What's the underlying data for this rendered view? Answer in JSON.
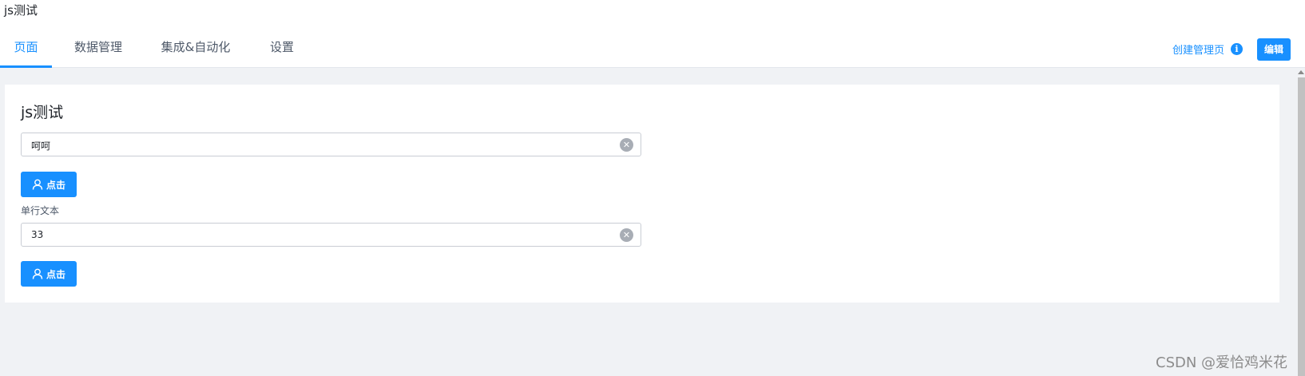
{
  "app_title": "js测试",
  "tabs": [
    {
      "label": "页面",
      "active": true
    },
    {
      "label": "数据管理",
      "active": false
    },
    {
      "label": "集成&自动化",
      "active": false
    },
    {
      "label": "设置",
      "active": false
    }
  ],
  "header_actions": {
    "create_label": "创建管理页",
    "info_icon": "info-icon",
    "info_glyph": "i",
    "edit_label": "编辑"
  },
  "card": {
    "title": "js测试",
    "input1": {
      "value": "呵呵"
    },
    "button1": {
      "label": "点击",
      "icon": "user-icon"
    },
    "field2_label": "单行文本",
    "input2": {
      "value": "33"
    },
    "button2": {
      "label": "点击",
      "icon": "user-icon"
    },
    "clear_glyph": "✕"
  },
  "watermark": "CSDN @爱恰鸡米花",
  "colors": {
    "accent": "#1890ff",
    "background": "#f0f2f5"
  }
}
